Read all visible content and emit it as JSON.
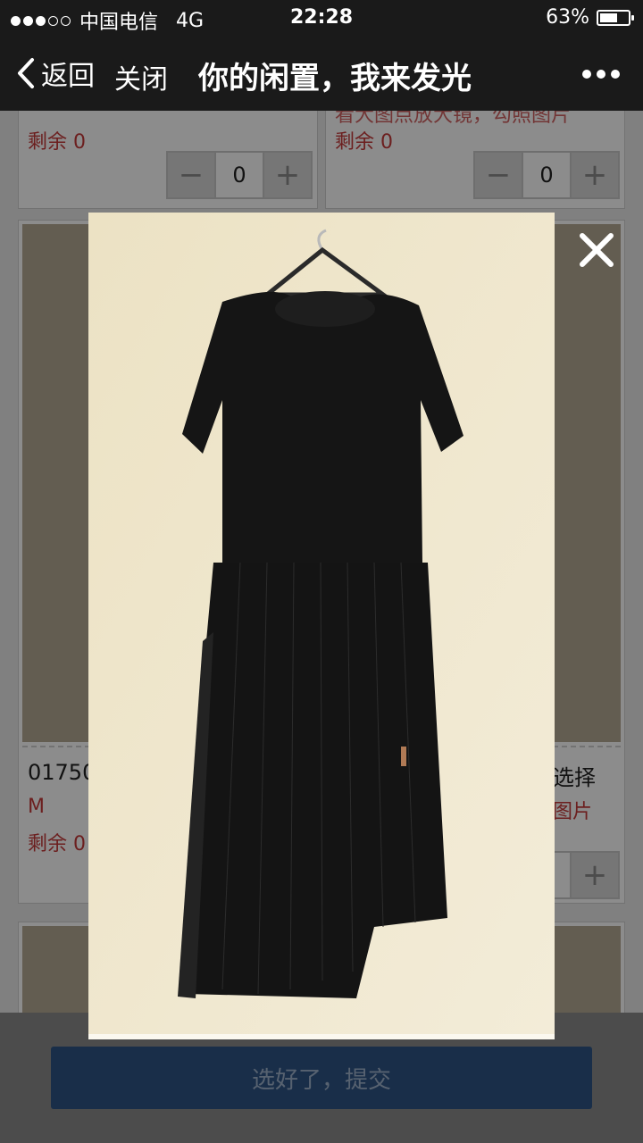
{
  "status": {
    "carrier": "中国电信",
    "network": "4G",
    "time": "22:28",
    "battery_text": "63%",
    "battery_level": 0.63
  },
  "nav": {
    "back_label": "返回",
    "close_label": "关闭",
    "title": "你的闲置，我来发光"
  },
  "cards": {
    "top_left": {
      "remain_label": "剩余 0",
      "qty": "0"
    },
    "top_right": {
      "partial_note": "看大图点放大镜，勾照图片",
      "remain_label": "剩余 0",
      "qty": "0"
    },
    "mid_left": {
      "code": "01750",
      "size": "M",
      "remain_label": "剩余 0"
    },
    "mid_right": {
      "select_label": "选择",
      "pic_label": "图片"
    }
  },
  "stepper": {
    "minus": "−",
    "plus": "+"
  },
  "footer": {
    "submit_label": "选好了，提交"
  },
  "colors": {
    "accent_button": "#2f5586",
    "remain_red": "#c53a3a",
    "statusbar_bg": "#1a1a1a"
  },
  "icons": {
    "back": "chevron-left-icon",
    "more": "ellipsis-icon",
    "close": "close-icon"
  }
}
